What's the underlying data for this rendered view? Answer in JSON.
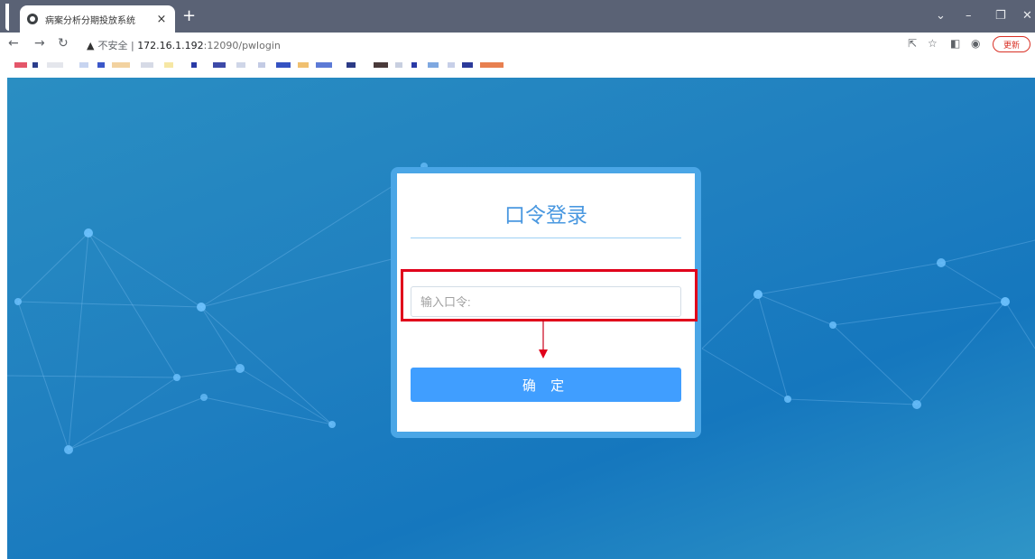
{
  "browser": {
    "tab_title": "病案分析分期投放系统",
    "tab_close": "×",
    "new_tab": "+",
    "url_warning_icon": "warning-triangle-icon",
    "url_insecure_label": "不安全",
    "url_separator": "|",
    "url_host": "172.16.1.192",
    "url_port_path": ":12090/pwlogin",
    "update_label": "更新",
    "colors": {
      "tabstrip": "#5a6275",
      "update": "#d93025"
    }
  },
  "login": {
    "title": "口令登录",
    "password_placeholder": "输入口令:",
    "confirm_label": "确 定",
    "colors": {
      "title": "#4a98e0",
      "button": "#409eff",
      "frame": "#4aa6e6",
      "annotation": "#e0001b"
    }
  }
}
